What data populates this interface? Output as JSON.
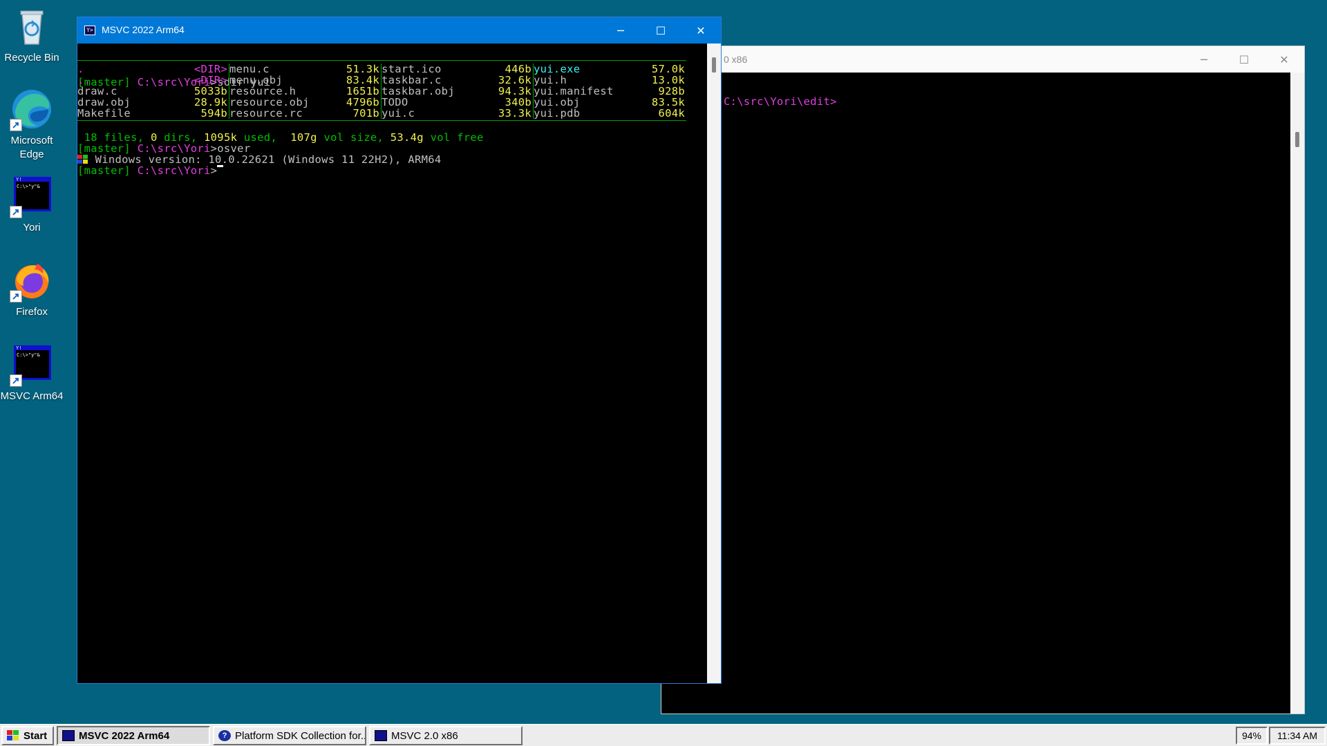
{
  "desktop": {
    "icons": [
      {
        "label": "Recycle Bin",
        "icon": "recycle-bin-icon"
      },
      {
        "label": "Microsoft Edge",
        "icon": "edge-icon"
      },
      {
        "label": "Yori",
        "icon": "console-icon"
      },
      {
        "label": "Firefox",
        "icon": "firefox-icon"
      },
      {
        "label": "MSVC Arm64",
        "icon": "console-icon"
      }
    ]
  },
  "window_back": {
    "title": "MSVC 2.0 x86",
    "title_visible": "0 x86",
    "prompt_path": "C:\\src\\Yori\\edit>"
  },
  "window_front": {
    "title": "MSVC 2022 Arm64",
    "icon_text": "Y>",
    "buttons": {
      "minimize": "─",
      "maximize": "☐",
      "close": "✕"
    },
    "lines": {
      "cmd1_branch": "[master]",
      "cmd1_path": "C:\\src\\Yori",
      "cmd1_rest": ">sdir yui",
      "summary": {
        "files": "18",
        "t1": " files, ",
        "dirs": "0",
        "t2": " dirs, ",
        "used": "1095k",
        "t3": " used,  ",
        "volsize": "107g",
        "t4": " vol size, ",
        "free": "53.4g",
        "t5": " vol free"
      },
      "cmd2_branch": "[master]",
      "cmd2_path": "C:\\src\\Yori",
      "cmd2_rest": ">osver",
      "osver": " Windows version: 10.0.22621 (Windows 11 22H2), ARM64",
      "cmd3_branch": "[master]",
      "cmd3_path": "C:\\src\\Yori",
      "cmd3_rest": ">"
    },
    "sdir": {
      "col1": [
        {
          "name": ".",
          "size": "<DIR>"
        },
        {
          "name": "..",
          "size": "<DIR>"
        },
        {
          "name": "draw.c",
          "size": "5033b"
        },
        {
          "name": "draw.obj",
          "size": "28.9k"
        },
        {
          "name": "Makefile",
          "size": "594b"
        }
      ],
      "col2": [
        {
          "name": "menu.c",
          "size": "51.3k"
        },
        {
          "name": "menu.obj",
          "size": "83.4k"
        },
        {
          "name": "resource.h",
          "size": "1651b"
        },
        {
          "name": "resource.obj",
          "size": "4796b"
        },
        {
          "name": "resource.rc",
          "size": "701b"
        }
      ],
      "col3": [
        {
          "name": "start.ico",
          "size": "446b"
        },
        {
          "name": "taskbar.c",
          "size": "32.6k"
        },
        {
          "name": "taskbar.obj",
          "size": "94.3k"
        },
        {
          "name": "TODO",
          "size": "340b"
        },
        {
          "name": "yui.c",
          "size": "33.3k"
        }
      ],
      "col4": [
        {
          "name": "yui.exe",
          "size": "57.0k"
        },
        {
          "name": "yui.h",
          "size": "13.0k"
        },
        {
          "name": "yui.manifest",
          "size": "928b"
        },
        {
          "name": "yui.obj",
          "size": "83.5k"
        },
        {
          "name": "yui.pdb",
          "size": "604k"
        }
      ]
    }
  },
  "taskbar": {
    "start_label": "Start",
    "items": [
      {
        "label": "MSVC 2022 Arm64",
        "active": true
      },
      {
        "label": "Platform SDK Collection for...",
        "active": false
      },
      {
        "label": "MSVC 2.0 x86",
        "active": false
      }
    ],
    "battery": "94%",
    "clock": "11:34 AM"
  },
  "colors": {
    "desktop": "#03627f",
    "titlebar_active": "#0078d7",
    "console_green": "#00c000",
    "console_magenta": "#e040e0",
    "console_yellow": "#f0f050",
    "console_cyan": "#40f0f0"
  }
}
